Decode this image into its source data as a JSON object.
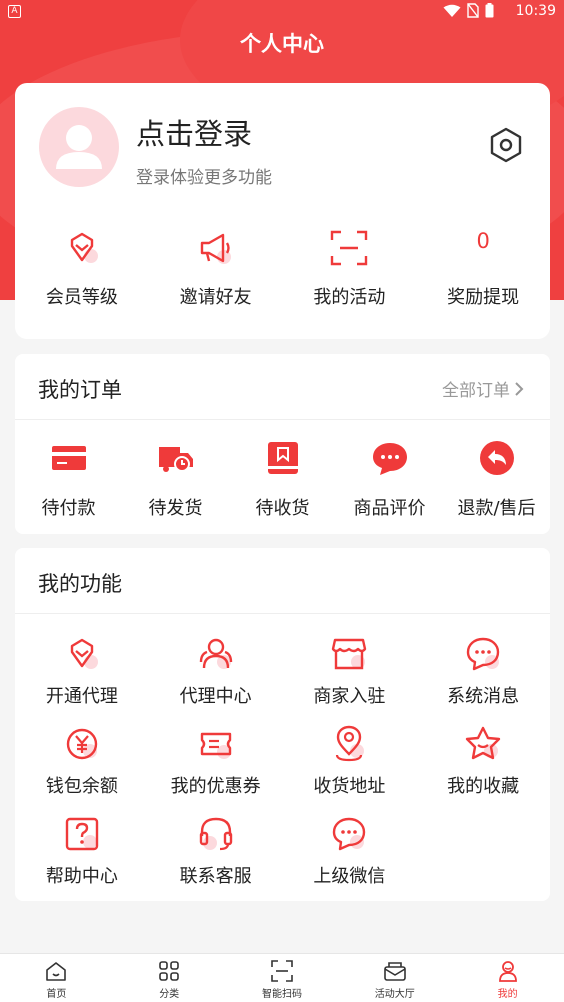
{
  "status_bar": {
    "time": "10:39",
    "app_icon_letter": "A"
  },
  "header": {
    "title": "个人中心"
  },
  "colors": {
    "accent": "#ef4040",
    "accent_light": "#fcd9dd"
  },
  "profile": {
    "login_title": "点击登录",
    "login_subtitle": "登录体验更多功能",
    "quick_items": [
      {
        "label": "会员等级",
        "icon": "diamond-icon"
      },
      {
        "label": "邀请好友",
        "icon": "megaphone-icon"
      },
      {
        "label": "我的活动",
        "icon": "scan-frame-icon"
      },
      {
        "label": "奖励提现",
        "value": "0"
      }
    ]
  },
  "orders": {
    "title": "我的订单",
    "view_all": "全部订单",
    "items": [
      {
        "label": "待付款",
        "icon": "card-icon"
      },
      {
        "label": "待发货",
        "icon": "truck-icon"
      },
      {
        "label": "待收货",
        "icon": "box-icon"
      },
      {
        "label": "商品评价",
        "icon": "chat-bubble-icon"
      },
      {
        "label": "退款/售后",
        "icon": "return-icon"
      }
    ]
  },
  "functions": {
    "title": "我的功能",
    "items": [
      {
        "label": "开通代理",
        "icon": "diamond-icon"
      },
      {
        "label": "代理中心",
        "icon": "group-icon"
      },
      {
        "label": "商家入驻",
        "icon": "store-icon"
      },
      {
        "label": "系统消息",
        "icon": "message-icon"
      },
      {
        "label": "钱包余额",
        "icon": "yuan-icon"
      },
      {
        "label": "我的优惠券",
        "icon": "coupon-icon"
      },
      {
        "label": "收货地址",
        "icon": "location-icon"
      },
      {
        "label": "我的收藏",
        "icon": "star-icon"
      },
      {
        "label": "帮助中心",
        "icon": "help-icon"
      },
      {
        "label": "联系客服",
        "icon": "headset-icon"
      },
      {
        "label": "上级微信",
        "icon": "wechat-icon"
      }
    ]
  },
  "tabbar": {
    "items": [
      {
        "label": "首页",
        "icon": "home-icon"
      },
      {
        "label": "分类",
        "icon": "category-icon"
      },
      {
        "label": "智能扫码",
        "icon": "scan-icon"
      },
      {
        "label": "活动大厅",
        "icon": "activity-icon"
      },
      {
        "label": "我的",
        "icon": "user-icon",
        "active": true
      }
    ]
  }
}
